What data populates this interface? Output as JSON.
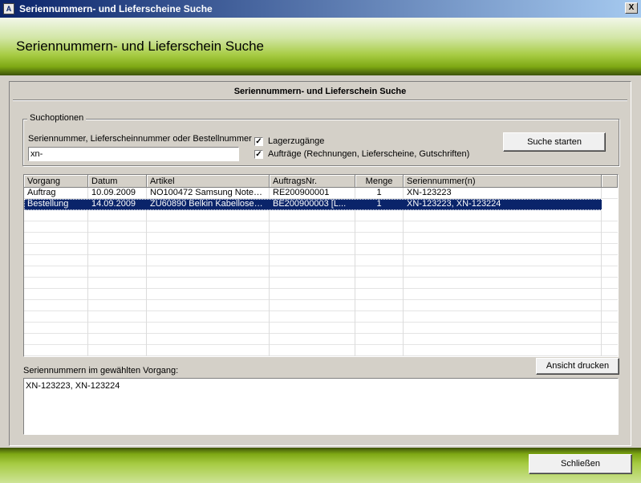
{
  "window": {
    "title": "Seriennummern- und Lieferscheine Suche",
    "icon_glyph": "A",
    "close_glyph": "X"
  },
  "header": {
    "title": "Seriennummern- und Lieferschein Suche"
  },
  "panel": {
    "title": "Seriennummern- und Lieferschein Suche"
  },
  "search_options": {
    "legend": "Suchoptionen",
    "field_label": "Seriennummer, Lieferscheinnummer oder Bestellnummer",
    "input_value": "xn-",
    "checkbox_1_label": "Lagerzugänge",
    "checkbox_1_checked": true,
    "checkbox_2_label": "Aufträge (Rechnungen, Lieferscheine, Gutschriften)",
    "checkbox_2_checked": true,
    "check_glyph": "✓",
    "search_button": "Suche starten"
  },
  "table": {
    "columns": [
      "Vorgang",
      "Datum",
      "Artikel",
      "AuftragsNr.",
      "Menge",
      "Seriennummer(n)"
    ],
    "rows": [
      [
        "Auftrag",
        "10.09.2009",
        "NO100472 Samsung Noteb...",
        "RE200900001",
        "1",
        "XN-123223"
      ],
      [
        "Bestellung",
        "14.09.2009",
        "ZU60890 Belkin Kabelloser ...",
        "BE200900003 [L...",
        "1",
        "XN-123223, XN-123224"
      ]
    ],
    "selected_row": 1
  },
  "selected_serials": {
    "label": "Seriennummern im gewählten Vorgang:",
    "value": "XN-123223, XN-123224",
    "print_button": "Ansicht drucken"
  },
  "footer": {
    "close_button": "Schließen"
  },
  "colors": {
    "accent_green": "#7ea814",
    "selection": "#0a246a"
  }
}
